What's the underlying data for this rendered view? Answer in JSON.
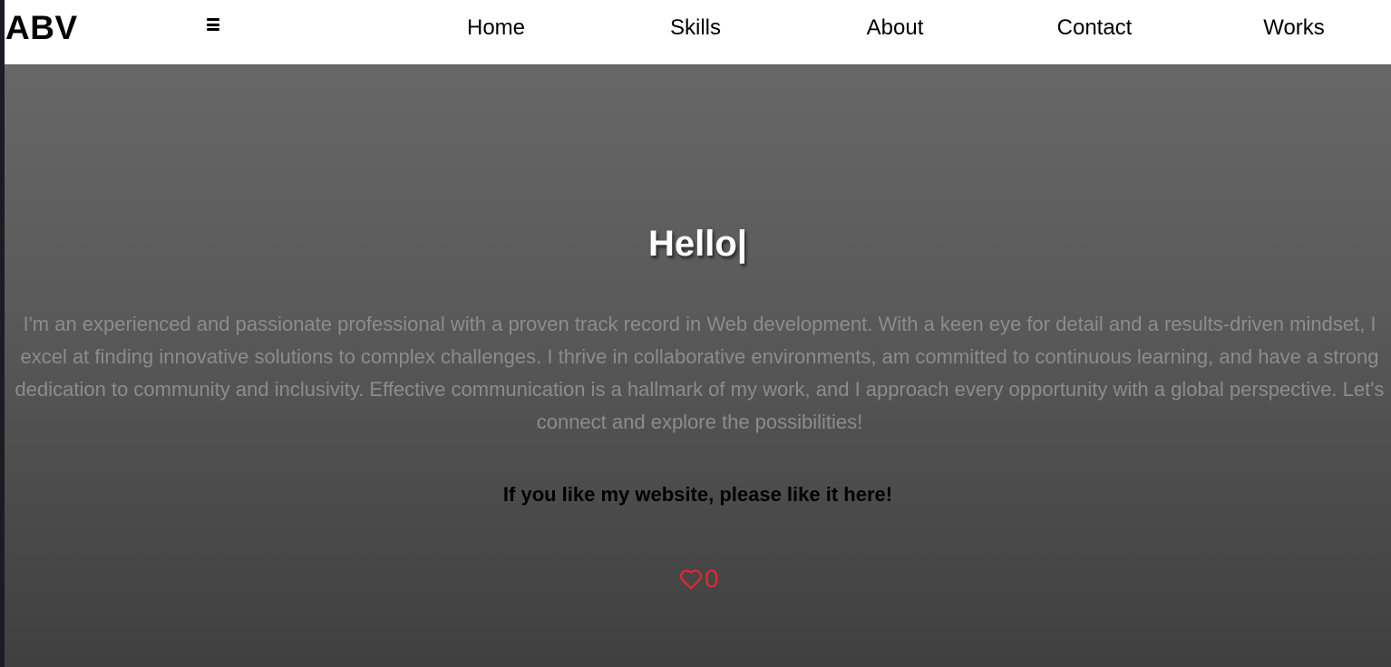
{
  "header": {
    "logo": "ABV",
    "menu_icon": "hamburger-menu-icon",
    "nav": [
      {
        "label": "Home"
      },
      {
        "label": "Skills"
      },
      {
        "label": "About"
      },
      {
        "label": "Contact"
      },
      {
        "label": "Works"
      }
    ]
  },
  "hero": {
    "greeting": "Hello|",
    "about": "I'm an experienced and passionate professional with a proven track record in Web development. With a keen eye for detail and a results-driven mindset, I excel at finding innovative solutions to complex challenges. I thrive in collaborative environments, am committed to continuous learning, and have a strong dedication to community and inclusivity. Effective communication is a hallmark of my work, and I approach every opportunity with a global perspective. Let's connect and explore the possibilities!",
    "like_prompt": "If you like my website, please like it here!",
    "like_icon": "heart-outline-icon",
    "like_count": "0"
  },
  "colors": {
    "accent": "#e3282e",
    "nav_background": "#ffffff",
    "hero_top": "#676767",
    "hero_bottom": "#404040",
    "body_text": "#8c8c8c"
  }
}
